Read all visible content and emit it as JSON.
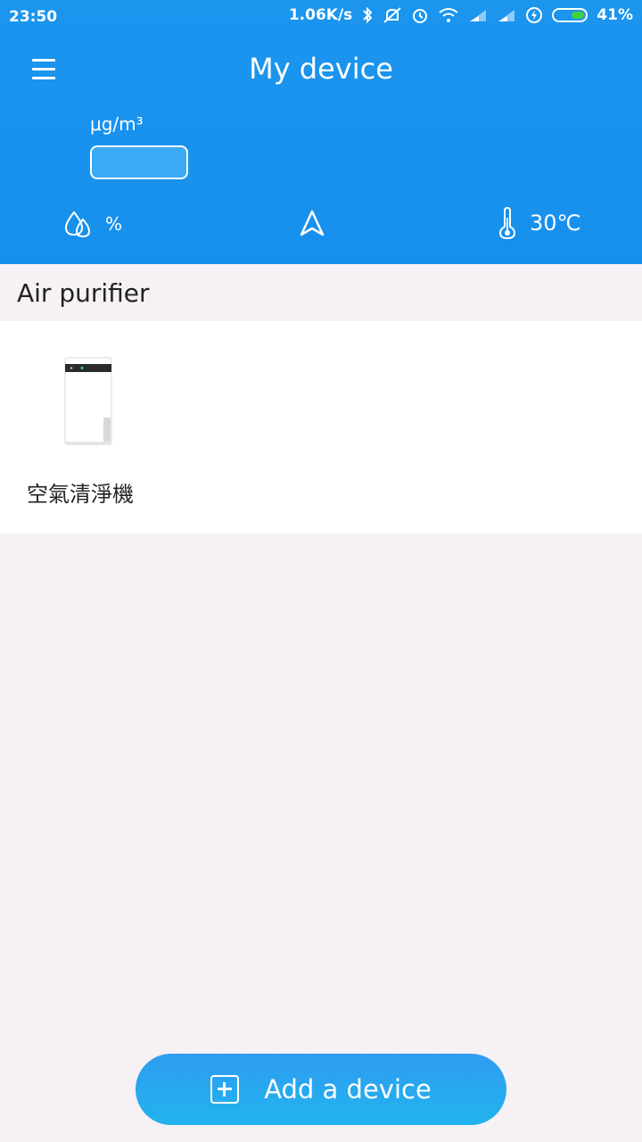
{
  "status_bar": {
    "time": "23:50",
    "network_speed": "1.06K/s",
    "battery_percent": "41%",
    "icons": [
      "bluetooth-icon",
      "mute-icon",
      "alarm-icon",
      "wifi-icon",
      "signal-icon",
      "signal-icon",
      "charging-icon",
      "battery-icon"
    ]
  },
  "header": {
    "title": "My device",
    "pm_unit": "μg/m³",
    "humidity_unit": "%",
    "temperature": "30℃"
  },
  "section": {
    "title": "Air purifier"
  },
  "devices": [
    {
      "name": "空氣清淨機"
    }
  ],
  "add_button": {
    "label": "Add a device"
  },
  "colors": {
    "header_blue": "#1690ec",
    "background": "#f5f1f5",
    "battery_green": "#44d13b"
  }
}
